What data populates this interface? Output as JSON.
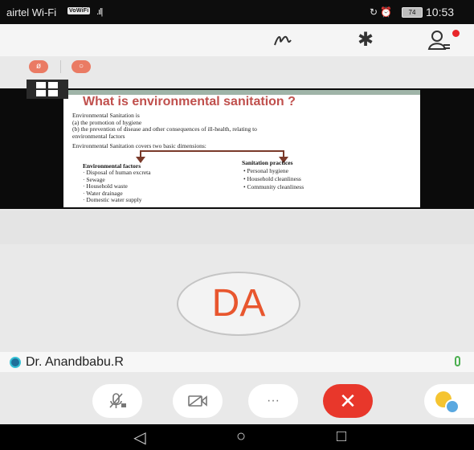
{
  "status_bar": {
    "carrier": "airtel Wi-Fi",
    "wifi_badge": "VoWiFi",
    "signal": ".ıl|",
    "right_icons": "↻ ⏰",
    "battery": "74",
    "time": "10:53"
  },
  "toolbar": {
    "pen_icon": "ᵆ",
    "bluetooth_icon": "✱",
    "participants_icon": "♙"
  },
  "pills": {
    "mic_off": "ø",
    "camera": "○"
  },
  "slide": {
    "title": "What is environmental sanitation ?",
    "intro": [
      "Environmental Sanitation is",
      "(a) the promotion of hygiene",
      "(b) the prevention of disease and other consequences of ill-health, relating to",
      "environmental factors"
    ],
    "covers": "Environmental Sanitation covers two basic dimensions:",
    "left_heading": "Environmental factors",
    "left_items": [
      "· Disposal of human excreta",
      "· Sewage",
      "· Household waste",
      "· Water drainage",
      "· Domestic water supply"
    ],
    "right_heading": "Sanitation practices",
    "right_items": [
      "• Personal hygiene",
      "• Household cleanliness",
      "• Community cleanliness"
    ]
  },
  "participant": {
    "initials": "DA",
    "name": "Dr. Anandbabu.R"
  },
  "controls": {
    "mic_off_icon": "⌀",
    "video_off_icon": "▭◁",
    "more_label": "···",
    "end_call_icon": "✕"
  },
  "nav": {
    "back": "◁",
    "home": "○",
    "recents": "□"
  },
  "colors": {
    "accent": "#e8562e",
    "end_call": "#e8372b",
    "slide_title": "#c0504d"
  }
}
